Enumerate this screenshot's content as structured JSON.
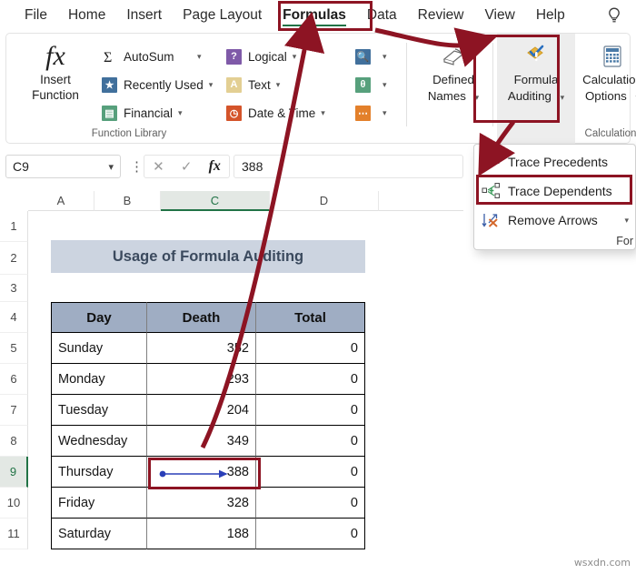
{
  "theme": {
    "accent_green": "#217346",
    "annotation_red": "#8d1423",
    "trace_blue": "#2a3fb8",
    "title_fill": "#ccd4e0",
    "header_fill": "#9fadc3"
  },
  "ribbon": {
    "tabs": [
      {
        "label": "File",
        "active": false
      },
      {
        "label": "Home",
        "active": false
      },
      {
        "label": "Insert",
        "active": false
      },
      {
        "label": "Page Layout",
        "active": false
      },
      {
        "label": "Formulas",
        "active": true
      },
      {
        "label": "Data",
        "active": false
      },
      {
        "label": "Review",
        "active": false
      },
      {
        "label": "View",
        "active": false
      },
      {
        "label": "Help",
        "active": false
      }
    ],
    "tell_me_icon": "lightbulb-icon",
    "groups": [
      {
        "name": "function-library",
        "label": "Function Library",
        "insert_function": {
          "line1": "Insert",
          "line2": "Function",
          "icon": "fx-icon"
        },
        "items": [
          {
            "label": "AutoSum",
            "icon": "sigma-icon",
            "has_chevron": true
          },
          {
            "label": "Recently Used",
            "icon": "recently-used-icon",
            "has_chevron": true
          },
          {
            "label": "Financial",
            "icon": "financial-icon",
            "has_chevron": true
          },
          {
            "label": "Logical",
            "icon": "logical-icon",
            "has_chevron": true
          },
          {
            "label": "Text",
            "icon": "text-icon",
            "has_chevron": true
          },
          {
            "label": "Date & Time",
            "icon": "date-time-icon",
            "has_chevron": true
          }
        ],
        "extra_icons": [
          {
            "icon": "lookup-reference-icon",
            "has_chevron": true
          },
          {
            "icon": "math-trig-icon",
            "has_chevron": true
          },
          {
            "icon": "more-functions-icon",
            "has_chevron": true
          }
        ]
      },
      {
        "name": "defined-names",
        "label": "",
        "button": {
          "line1": "Defined",
          "line2": "Names",
          "icon": "defined-names-icon",
          "has_chevron": true
        }
      },
      {
        "name": "formula-auditing",
        "label": "",
        "highlighted": true,
        "button": {
          "line1": "Formula",
          "line2": "Auditing",
          "icon": "formula-auditing-icon",
          "has_chevron": true
        }
      },
      {
        "name": "calculation",
        "label": "Calculation",
        "button": {
          "line1": "Calculation",
          "line2": "Options",
          "icon": "calculator-icon",
          "has_chevron": true
        }
      }
    ]
  },
  "formula_bar": {
    "name_box_value": "C9",
    "cancel_icon": "close-icon",
    "enter_icon": "check-icon",
    "insert_function_icon": "fx-icon",
    "formula_value": "388"
  },
  "grid": {
    "column_headers": [
      "A",
      "B",
      "C",
      "D"
    ],
    "selected_column": "C",
    "row_headers": [
      "1",
      "2",
      "3",
      "4",
      "5",
      "6",
      "7",
      "8",
      "9",
      "10",
      "11"
    ],
    "selected_row": "9",
    "title_cell": "Usage of Formula Auditing",
    "table": {
      "columns": [
        "Day",
        "Death",
        "Total"
      ],
      "rows": [
        {
          "day": "Sunday",
          "death": "352",
          "total": "0"
        },
        {
          "day": "Monday",
          "death": "293",
          "total": "0"
        },
        {
          "day": "Tuesday",
          "death": "204",
          "total": "0"
        },
        {
          "day": "Wednesday",
          "death": "349",
          "total": "0"
        },
        {
          "day": "Thursday",
          "death": "388",
          "total": "0"
        },
        {
          "day": "Friday",
          "death": "328",
          "total": "0"
        },
        {
          "day": "Saturday",
          "death": "188",
          "total": "0"
        }
      ]
    },
    "trace_arrow": {
      "type": "trace-dependents-arrow",
      "from_cell": "C9",
      "to_cell": "D9",
      "color": "#2a3fb8"
    }
  },
  "dropdown_menu": {
    "name": "formula-auditing-menu",
    "items": [
      {
        "label": "Trace Precedents",
        "icon": "trace-precedents-icon",
        "has_chevron": false,
        "highlighted": false
      },
      {
        "label": "Trace Dependents",
        "icon": "trace-dependents-icon",
        "has_chevron": false,
        "highlighted": true
      },
      {
        "label": "Remove Arrows",
        "icon": "remove-arrows-icon",
        "has_chevron": true,
        "highlighted": false
      }
    ],
    "footer_label": "For"
  },
  "annotations": {
    "highlight_boxes": [
      {
        "target": "Formulas tab"
      },
      {
        "target": "Formula Auditing button"
      },
      {
        "target": "Trace Dependents menu item"
      },
      {
        "target": "Cell C9"
      }
    ],
    "arrows": [
      {
        "from": "Formulas tab",
        "to": "Formula Auditing button"
      },
      {
        "from": "Formula Auditing button",
        "to": "Trace Precedents menu item"
      },
      {
        "from": "Cell C9",
        "to": "Formulas tab"
      }
    ]
  },
  "watermark": "wsxdn.com"
}
